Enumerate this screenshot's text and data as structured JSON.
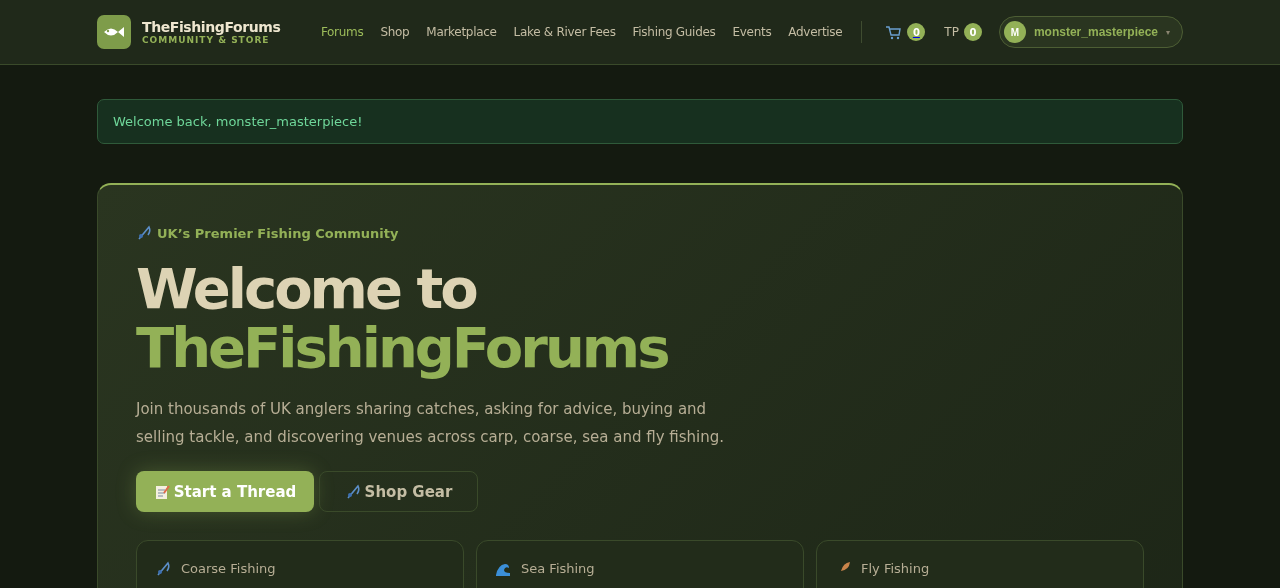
{
  "brand": {
    "name": "TheFishingForums",
    "tagline": "COMMUNITY & STORE"
  },
  "nav": [
    {
      "label": "Forums",
      "selected": true
    },
    {
      "label": "Shop",
      "selected": false
    },
    {
      "label": "Marketplace",
      "selected": false
    },
    {
      "label": "Lake & River Fees",
      "selected": false
    },
    {
      "label": "Fishing Guides",
      "selected": false
    },
    {
      "label": "Events",
      "selected": false
    },
    {
      "label": "Advertise",
      "selected": false
    }
  ],
  "cart": {
    "count": "0"
  },
  "tp": {
    "label": "TP",
    "count": "0"
  },
  "user": {
    "initial": "M",
    "name": "monster_masterpiece",
    "caret": "▾"
  },
  "alert": {
    "message": "Welcome back, monster_masterpiece!"
  },
  "hero": {
    "eyebrow": "UK’s Premier Fishing Community",
    "title_line1": "Welcome to",
    "title_line2": "TheFishingForums",
    "description": "Join thousands of UK anglers sharing catches, asking for advice, buying and selling tackle, and discovering venues across carp, coarse, sea and fly fishing.",
    "buttons": [
      {
        "label": "Start a Thread",
        "kind": "primary"
      },
      {
        "label": "Shop Gear",
        "kind": "secondary"
      }
    ]
  },
  "categories": [
    {
      "label": "Coarse Fishing",
      "kind": "rod"
    },
    {
      "label": "Sea Fishing",
      "kind": "wave"
    },
    {
      "label": "Fly Fishing",
      "kind": "feather"
    }
  ]
}
